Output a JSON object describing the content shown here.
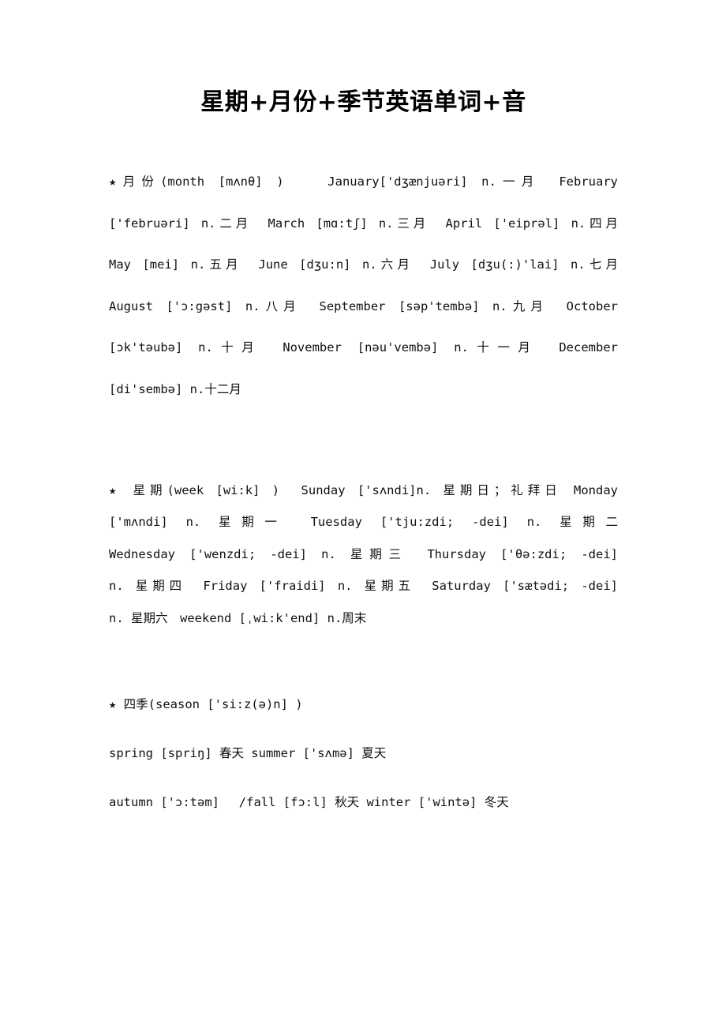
{
  "document": {
    "title": "星期+月份+季节英语单词+音",
    "sections": [
      {
        "name": "months",
        "heading_marker": "★",
        "heading": "月份(month [mʌnθ] )",
        "lines": [
          "★月份(month [mʌnθ] )　　January['dʒænjuəri] n.一月　February",
          "['februəri] n.二月　March [mɑ:tʃ] n.三月　April ['eiprəl] n.四月",
          "May [mei] n.五月　June [dʒu:n] n.六月　July [dʒu(:)'lai] n.七月",
          "August ['ɔ:gəst] n.八月　September [səp'tembə] n.九月　October",
          "[ɔk'təubə] n.十月　November [nəu'vembə] n.十一月　December",
          "[di'sembə] n.十二月"
        ],
        "entries": [
          {
            "word": "month",
            "phonetic": "[mʌnθ]",
            "pos": "",
            "meaning": "月份"
          },
          {
            "word": "January",
            "phonetic": "['dʒænjuəri]",
            "pos": "n.",
            "meaning": "一月"
          },
          {
            "word": "February",
            "phonetic": "['februəri]",
            "pos": "n.",
            "meaning": "二月"
          },
          {
            "word": "March",
            "phonetic": "[mɑ:tʃ]",
            "pos": "n.",
            "meaning": "三月"
          },
          {
            "word": "April",
            "phonetic": "['eiprəl]",
            "pos": "n.",
            "meaning": "四月"
          },
          {
            "word": "May",
            "phonetic": "[mei]",
            "pos": "n.",
            "meaning": "五月"
          },
          {
            "word": "June",
            "phonetic": "[dʒu:n]",
            "pos": "n.",
            "meaning": "六月"
          },
          {
            "word": "July",
            "phonetic": "[dʒu(:)'lai]",
            "pos": "n.",
            "meaning": "七月"
          },
          {
            "word": "August",
            "phonetic": "['ɔ:gəst]",
            "pos": "n.",
            "meaning": "八月"
          },
          {
            "word": "September",
            "phonetic": "[səp'tembə]",
            "pos": "n.",
            "meaning": "九月"
          },
          {
            "word": "October",
            "phonetic": "[ɔk'təubə]",
            "pos": "n.",
            "meaning": "十月"
          },
          {
            "word": "November",
            "phonetic": "[nəu'vembə]",
            "pos": "n.",
            "meaning": "十一月"
          },
          {
            "word": "December",
            "phonetic": "[di'sembə]",
            "pos": "n.",
            "meaning": "十二月"
          }
        ]
      },
      {
        "name": "weekdays",
        "heading_marker": "★",
        "heading": "星期(week [wi:k] )",
        "lines": [
          "★ 星期(week [wi:k] )　Sunday ['sʌndi]n. 星期日；礼拜日 Monday",
          "['mʌndi] n. 星期一　Tuesday ['tju:zdi; -dei] n. 星期二",
          "Wednesday ['wenzdi; -dei] n. 星期三　Thursday ['θə:zdi; -dei]",
          "n. 星期四　Friday ['fraidi] n. 星期五　Saturday ['sætədi; -dei]",
          "n. 星期六　weekend [ˌwi:k'end] n.周末"
        ],
        "entries": [
          {
            "word": "week",
            "phonetic": "[wi:k]",
            "pos": "",
            "meaning": "星期"
          },
          {
            "word": "Sunday",
            "phonetic": "['sʌndi]",
            "pos": "n.",
            "meaning": "星期日；礼拜日"
          },
          {
            "word": "Monday",
            "phonetic": "['mʌndi]",
            "pos": "n.",
            "meaning": "星期一"
          },
          {
            "word": "Tuesday",
            "phonetic": "['tju:zdi; -dei]",
            "pos": "n.",
            "meaning": "星期二"
          },
          {
            "word": "Wednesday",
            "phonetic": "['wenzdi; -dei]",
            "pos": "n.",
            "meaning": "星期三"
          },
          {
            "word": "Thursday",
            "phonetic": "['θə:zdi; -dei]",
            "pos": "n.",
            "meaning": "星期四"
          },
          {
            "word": "Friday",
            "phonetic": "['fraidi]",
            "pos": "n.",
            "meaning": "星期五"
          },
          {
            "word": "Saturday",
            "phonetic": "['sætədi; -dei]",
            "pos": "n.",
            "meaning": "星期六"
          },
          {
            "word": "weekend",
            "phonetic": "[ˌwi:k'end]",
            "pos": "n.",
            "meaning": "周末"
          }
        ]
      },
      {
        "name": "seasons",
        "heading_marker": "★",
        "heading": "四季(season ['si:z(ə)n] )",
        "lines": [
          "★ 四季(season ['si:z(ə)n] )",
          "spring [spriŋ] 春天 summer ['sʌmə] 夏天",
          "autumn ['ɔ:təm] 　/fall [fɔ:l] 秋天 winter ['wintə] 冬天"
        ],
        "entries": [
          {
            "word": "season",
            "phonetic": "['si:z(ə)n]",
            "pos": "",
            "meaning": "四季"
          },
          {
            "word": "spring",
            "phonetic": "[spriŋ]",
            "pos": "",
            "meaning": "春天"
          },
          {
            "word": "summer",
            "phonetic": "['sʌmə]",
            "pos": "",
            "meaning": "夏天"
          },
          {
            "word": "autumn",
            "phonetic": "['ɔ:təm]",
            "pos": "",
            "meaning": "秋天"
          },
          {
            "word": "fall",
            "phonetic": "[fɔ:l]",
            "pos": "",
            "meaning": "秋天"
          },
          {
            "word": "winter",
            "phonetic": "['wintə]",
            "pos": "",
            "meaning": "冬天"
          }
        ]
      }
    ]
  }
}
